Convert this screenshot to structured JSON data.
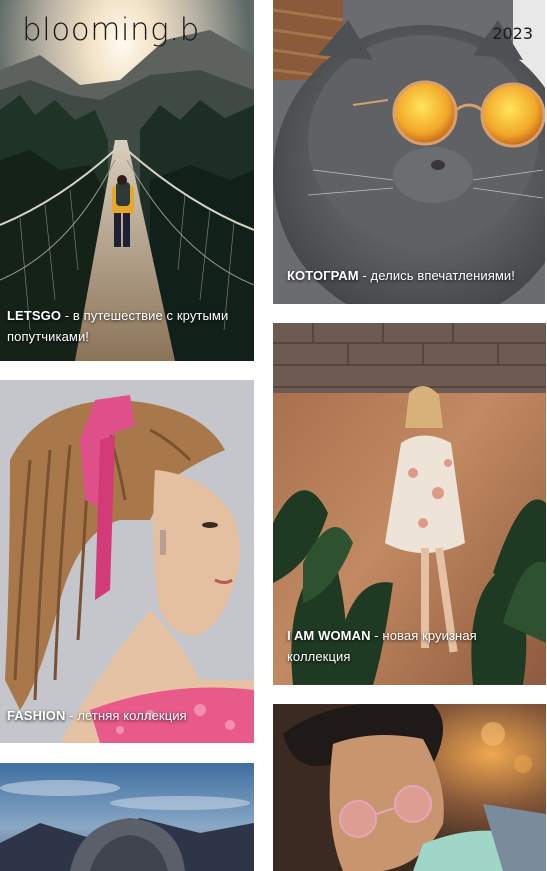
{
  "header": {
    "logo": "blooming.b"
  },
  "tiles": [
    {
      "tag": "LETSGO",
      "text": " - в путешествие с крутыми попутчиками!"
    },
    {
      "tag": "КОТОГРАМ",
      "text": " - делись впечатлениями!",
      "badge": "2023"
    },
    {
      "tag": "I AM WOMAN",
      "text": " - новая круизная коллекция"
    },
    {
      "tag": "FASHION",
      "text": " - летняя коллекция"
    },
    {
      "tag": "",
      "text": ""
    },
    {
      "tag": "",
      "text": ""
    }
  ]
}
